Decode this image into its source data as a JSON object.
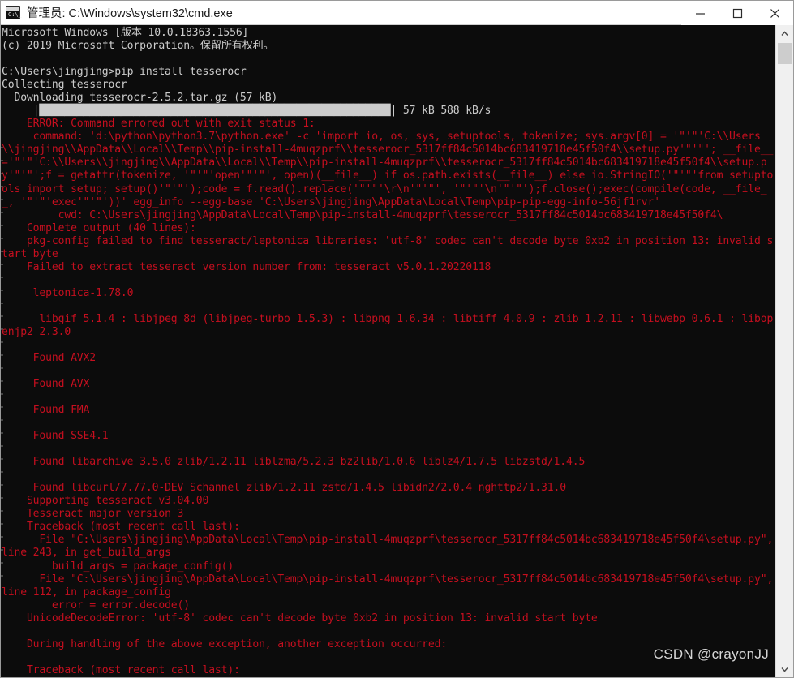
{
  "window": {
    "title": "管理员: C:\\Windows\\system32\\cmd.exe",
    "icon": "cmd-console-icon",
    "background_color": "#0c0c0c",
    "titlebar_color": "#ffffff",
    "controls": [
      {
        "name": "minimize",
        "glyph": "—"
      },
      {
        "name": "maximize",
        "glyph": "▢"
      },
      {
        "name": "close",
        "glyph": "✕"
      }
    ]
  },
  "colors": {
    "console_bg": "#0c0c0c",
    "normal_text": "#cccccc",
    "error_text": "#c50f1f",
    "scrollbar_track": "#f0f0f0",
    "scrollbar_thumb": "#cdcdcd"
  },
  "scrollbar": {
    "up_arrow": "▲",
    "down_arrow": "▼",
    "thumb_position": "near-top"
  },
  "watermark": {
    "text": "CSDN @crayonJJ"
  },
  "terminal": {
    "prompt": "C:\\Users\\jingjing>",
    "command": "pip install tesserocr",
    "progress_bar": {
      "blocks": "████████████████████████████████████████████████████████████",
      "downloaded": "57 kB",
      "speed": "588 kB/s",
      "separator_left": "|",
      "separator_right": "|"
    },
    "lines": [
      {
        "color": "white",
        "text": "Microsoft Windows [版本 10.0.18363.1556]"
      },
      {
        "color": "white",
        "text": "(c) 2019 Microsoft Corporation。保留所有权利。"
      },
      {
        "color": "white",
        "text": ""
      },
      {
        "color": "white",
        "text": "C:\\Users\\jingjing>pip install tesserocr"
      },
      {
        "color": "white",
        "text": "Collecting tesserocr"
      },
      {
        "color": "white",
        "text": "  Downloading tesserocr-2.5.2.tar.gz (57 kB)"
      },
      {
        "color": "bar",
        "text": "     |████████████████████████████████████████████████████████| 57 kB 588 kB/s"
      },
      {
        "color": "red",
        "text": "    ERROR: Command errored out with exit status 1:"
      },
      {
        "color": "red",
        "text": "     command: 'd:\\python\\python3.7\\python.exe' -c 'import io, os, sys, setuptools, tokenize; sys.argv[0] = '\"'\"'C:\\\\Users\\\\jingjing\\\\AppData\\\\Local\\\\Temp\\\\pip-install-4muqzprf\\\\tesserocr_5317ff84c5014bc683419718e45f50f4\\\\setup.py'\"'\"'; __file__='\"'\"'C:\\\\Users\\\\jingjing\\\\AppData\\\\Local\\\\Temp\\\\pip-install-4muqzprf\\\\tesserocr_5317ff84c5014bc683419718e45f50f4\\\\setup.py'\"'\"';f = getattr(tokenize, '\"'\"'open'\"'\"', open)(__file__) if os.path.exists(__file__) else io.StringIO('\"'\"'from setuptools import setup; setup()'\"'\"');code = f.read().replace('\"'\"'\\r\\n'\"'\"', '\"'\"'\\n'\"'\"');f.close();exec(compile(code, __file__, '\"'\"'exec'\"'\"'))' egg_info --egg-base 'C:\\Users\\jingjing\\AppData\\Local\\Temp\\pip-pip-egg-info-56jf1rvr'"
      },
      {
        "color": "red",
        "text": "         cwd: C:\\Users\\jingjing\\AppData\\Local\\Temp\\pip-install-4muqzprf\\tesserocr_5317ff84c5014bc683419718e45f50f4\\"
      },
      {
        "color": "red",
        "text": "    Complete output (40 lines):"
      },
      {
        "color": "red",
        "text": "    pkg-config failed to find tesseract/leptonica libraries: 'utf-8' codec can't decode byte 0xb2 in position 13: invalid start byte"
      },
      {
        "color": "red",
        "text": "    Failed to extract tesseract version number from: tesseract v5.0.1.20220118"
      },
      {
        "color": "red",
        "text": ""
      },
      {
        "color": "red",
        "text": "     leptonica-1.78.0"
      },
      {
        "color": "red",
        "text": ""
      },
      {
        "color": "red",
        "text": "      libgif 5.1.4 : libjpeg 8d (libjpeg-turbo 1.5.3) : libpng 1.6.34 : libtiff 4.0.9 : zlib 1.2.11 : libwebp 0.6.1 : libopenjp2 2.3.0"
      },
      {
        "color": "red",
        "text": ""
      },
      {
        "color": "red",
        "text": "     Found AVX2"
      },
      {
        "color": "red",
        "text": ""
      },
      {
        "color": "red",
        "text": "     Found AVX"
      },
      {
        "color": "red",
        "text": ""
      },
      {
        "color": "red",
        "text": "     Found FMA"
      },
      {
        "color": "red",
        "text": ""
      },
      {
        "color": "red",
        "text": "     Found SSE4.1"
      },
      {
        "color": "red",
        "text": ""
      },
      {
        "color": "red",
        "text": "     Found libarchive 3.5.0 zlib/1.2.11 liblzma/5.2.3 bz2lib/1.0.6 liblz4/1.7.5 libzstd/1.4.5"
      },
      {
        "color": "red",
        "text": ""
      },
      {
        "color": "red",
        "text": "     Found libcurl/7.77.0-DEV Schannel zlib/1.2.11 zstd/1.4.5 libidn2/2.0.4 nghttp2/1.31.0"
      },
      {
        "color": "red",
        "text": "    Supporting tesseract v3.04.00"
      },
      {
        "color": "red",
        "text": "    Tesseract major version 3"
      },
      {
        "color": "red",
        "text": "    Traceback (most recent call last):"
      },
      {
        "color": "red",
        "text": "      File \"C:\\Users\\jingjing\\AppData\\Local\\Temp\\pip-install-4muqzprf\\tesserocr_5317ff84c5014bc683419718e45f50f4\\setup.py\", line 243, in get_build_args"
      },
      {
        "color": "red",
        "text": "        build_args = package_config()"
      },
      {
        "color": "red",
        "text": "      File \"C:\\Users\\jingjing\\AppData\\Local\\Temp\\pip-install-4muqzprf\\tesserocr_5317ff84c5014bc683419718e45f50f4\\setup.py\", line 112, in package_config"
      },
      {
        "color": "red",
        "text": "        error = error.decode()"
      },
      {
        "color": "red",
        "text": "    UnicodeDecodeError: 'utf-8' codec can't decode byte 0xb2 in position 13: invalid start byte"
      },
      {
        "color": "red",
        "text": ""
      },
      {
        "color": "red",
        "text": "    During handling of the above exception, another exception occurred:"
      },
      {
        "color": "red",
        "text": ""
      },
      {
        "color": "red",
        "text": "    Traceback (most recent call last):"
      }
    ]
  }
}
